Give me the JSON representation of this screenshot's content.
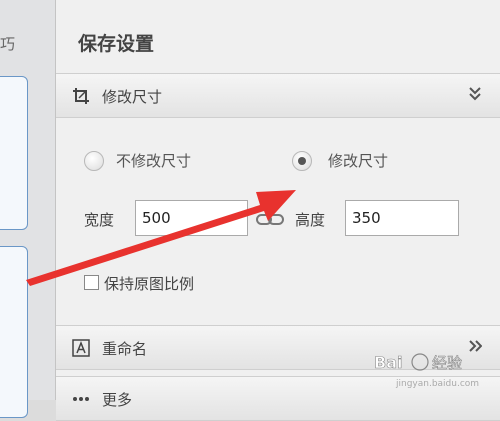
{
  "left_strip": {
    "partial_text": "巧"
  },
  "panel": {
    "title": "保存设置"
  },
  "resize_section": {
    "header_label": "修改尺寸",
    "no_resize_label": "不修改尺寸",
    "resize_label": "修改尺寸",
    "selected_option": "修改尺寸",
    "width_label": "宽度",
    "width_value": "500",
    "height_label": "高度",
    "height_value": "350",
    "keep_ratio_label": "保持原图比例",
    "keep_ratio_checked": false
  },
  "rename_section": {
    "header_label": "重命名"
  },
  "more_section": {
    "header_label": "更多"
  },
  "icons": {
    "resize": "crop-icon",
    "rename": "text-box-icon",
    "link": "chain-link-icon",
    "collapse": "double-chevron-down-icon",
    "expand": "double-chevron-right-icon"
  },
  "colors": {
    "arrow": "#e8322e",
    "panel_bg": "#f0f0f0",
    "card_border": "#6a97c7"
  },
  "watermark": {
    "text": "Bai 经验",
    "subtext": "jingyan.baidu.com"
  }
}
